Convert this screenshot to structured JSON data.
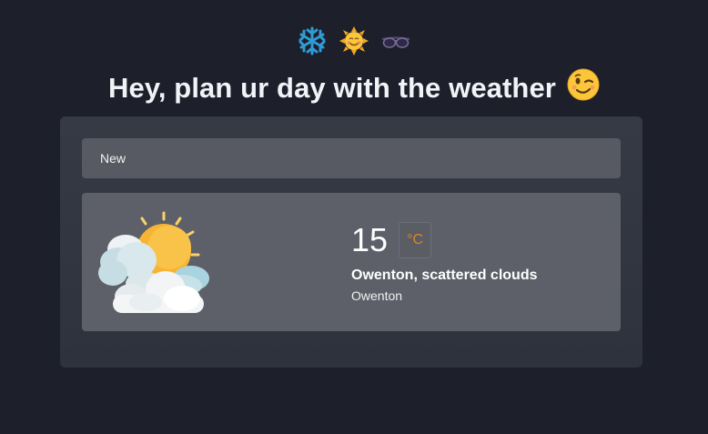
{
  "header": {
    "emoji_icons": [
      "snowflake-icon",
      "smiling-sun-icon",
      "sunglasses-icon"
    ],
    "headline": "Hey, plan ur day with the weather",
    "headline_icon": "winking-face-icon"
  },
  "new_bar": {
    "label": "New"
  },
  "weather": {
    "icon": "sun-behind-clouds-icon",
    "temperature": "15",
    "unit": "°C",
    "description": "Owenton, scattered clouds",
    "city": "Owenton"
  },
  "colors": {
    "background": "#1d202b",
    "panel": "#343843",
    "bar": "#575a62",
    "card": "#5d6068",
    "unit_accent": "#d9862b"
  }
}
